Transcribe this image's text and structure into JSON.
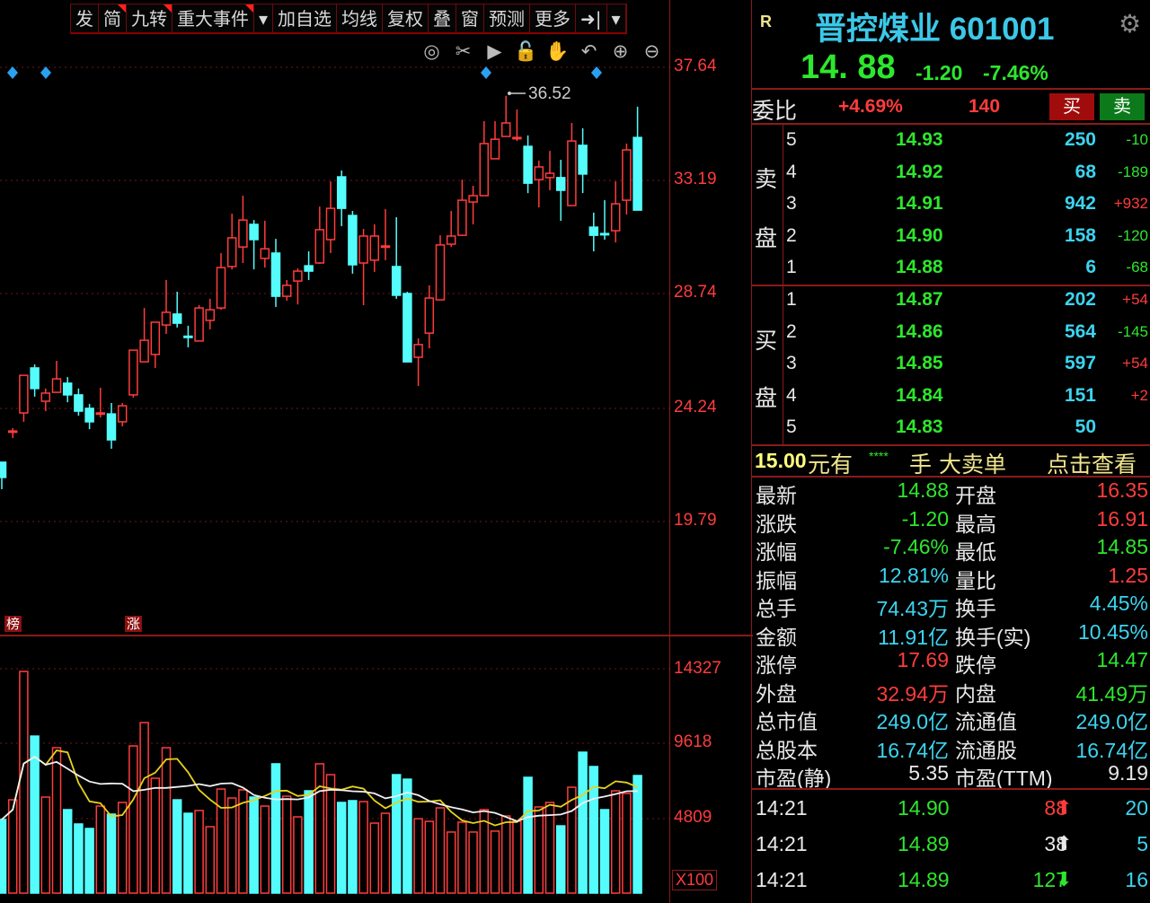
{
  "toolbar": {
    "items": [
      {
        "label": "发",
        "flag": false
      },
      {
        "label": "简",
        "flag": true
      },
      {
        "label": "九转",
        "flag": true
      },
      {
        "label": "重大事件",
        "flag": true
      },
      {
        "label": "▾",
        "flag": false
      },
      {
        "label": "加自选",
        "flag": false
      },
      {
        "label": "均线",
        "flag": false
      },
      {
        "label": "复权",
        "flag": false
      },
      {
        "label": "叠",
        "flag": false
      },
      {
        "label": "窗",
        "flag": false
      },
      {
        "label": "预测",
        "flag": false
      },
      {
        "label": "更多",
        "flag": false
      },
      {
        "label": "➜|",
        "flag": false
      },
      {
        "label": "▾",
        "flag": false
      }
    ],
    "icons": [
      "eye-icon",
      "scissors-icon",
      "play-icon",
      "lock-icon",
      "hand-icon",
      "undo-icon",
      "zoom-in-icon",
      "zoom-out-icon"
    ]
  },
  "chart_data": {
    "type": "candlestick",
    "price_axis": {
      "ticks": [
        "37.64",
        "33.19",
        "28.74",
        "24.24",
        "19.79"
      ],
      "range": [
        19.79,
        37.64
      ]
    },
    "high_label": "36.52",
    "markers": [
      {
        "label": "榜"
      },
      {
        "label": "涨"
      }
    ],
    "volume_axis": {
      "ticks": [
        "14327",
        "9618",
        "4809"
      ],
      "unit": "X100"
    },
    "ma_periods": [
      5,
      10
    ],
    "colors": {
      "up": "#ff3c3c",
      "down": "#54fcfc",
      "ma5": "#e6d21e",
      "ma10": "#f0f0f0",
      "event": "#2aa0f0"
    },
    "event_candles": [
      1,
      4,
      44,
      54
    ],
    "candles": [
      [
        22.1,
        21.5,
        22.1,
        21.04
      ],
      [
        23.3,
        23.33,
        23.44,
        23.05
      ],
      [
        24.04,
        25.52,
        25.52,
        23.69
      ],
      [
        25.81,
        25.0,
        25.95,
        24.68
      ],
      [
        24.5,
        24.82,
        25.0,
        24.11
      ],
      [
        24.85,
        25.38,
        26.09,
        24.85
      ],
      [
        25.21,
        24.75,
        25.45,
        24.46
      ],
      [
        24.75,
        24.11,
        25.0,
        23.93
      ],
      [
        24.22,
        23.69,
        24.39,
        23.4
      ],
      [
        24.0,
        24.04,
        25.03,
        23.86
      ],
      [
        24.0,
        22.98,
        24.43,
        22.63
      ],
      [
        23.69,
        24.32,
        24.43,
        23.51
      ],
      [
        24.75,
        26.51,
        26.51,
        24.64
      ],
      [
        26.05,
        26.9,
        28.17,
        26.05
      ],
      [
        26.34,
        27.61,
        27.61,
        25.81
      ],
      [
        27.5,
        28.0,
        29.27,
        27.15
      ],
      [
        27.93,
        27.57,
        28.81,
        27.4
      ],
      [
        27.06,
        27.04,
        27.47,
        26.62
      ],
      [
        26.87,
        28.17,
        28.28,
        26.87
      ],
      [
        27.68,
        28.1,
        28.53,
        27.33
      ],
      [
        28.17,
        29.76,
        30.33,
        28.1
      ],
      [
        29.8,
        30.93,
        31.88,
        29.69
      ],
      [
        30.57,
        31.63,
        32.59,
        29.94
      ],
      [
        31.46,
        30.86,
        31.63,
        29.69
      ],
      [
        30.12,
        30.5,
        31.6,
        29.76
      ],
      [
        30.33,
        28.63,
        30.89,
        28.21
      ],
      [
        28.63,
        29.06,
        29.27,
        28.46
      ],
      [
        29.23,
        29.62,
        29.73,
        28.31
      ],
      [
        29.83,
        29.62,
        30.4,
        29.27
      ],
      [
        29.94,
        31.25,
        32.16,
        29.9
      ],
      [
        30.86,
        32.09,
        33.15,
        30.33
      ],
      [
        33.33,
        32.09,
        33.58,
        31.39
      ],
      [
        31.81,
        29.87,
        31.99,
        29.52
      ],
      [
        29.94,
        31.0,
        31.28,
        28.28
      ],
      [
        30.05,
        31.0,
        31.46,
        29.59
      ],
      [
        30.58,
        30.61,
        32.06,
        30.05
      ],
      [
        29.8,
        28.67,
        31.74,
        28.53
      ],
      [
        28.74,
        26.05,
        28.81,
        26.05
      ],
      [
        26.23,
        26.73,
        26.97,
        25.1
      ],
      [
        27.18,
        28.56,
        29.06,
        26.58
      ],
      [
        28.49,
        30.65,
        31.03,
        28.49
      ],
      [
        30.68,
        31.0,
        31.99,
        30.57
      ],
      [
        31.03,
        32.41,
        33.22,
        31.0
      ],
      [
        32.34,
        32.59,
        32.98,
        31.46
      ],
      [
        32.59,
        34.64,
        35.52,
        32.59
      ],
      [
        34.04,
        34.81,
        35.52,
        34.04
      ],
      [
        34.92,
        35.45,
        36.52,
        34.92
      ],
      [
        34.85,
        34.88,
        35.98,
        34.74
      ],
      [
        34.53,
        33.08,
        34.96,
        32.69
      ],
      [
        33.22,
        33.72,
        33.97,
        32.13
      ],
      [
        33.3,
        33.47,
        34.35,
        32.8
      ],
      [
        33.3,
        32.8,
        34.0,
        31.6
      ],
      [
        32.2,
        34.74,
        35.45,
        32.2
      ],
      [
        34.57,
        33.44,
        35.24,
        32.69
      ],
      [
        31.35,
        31.03,
        31.92,
        30.4
      ],
      [
        31.1,
        31.07,
        32.41,
        30.86
      ],
      [
        31.21,
        32.27,
        33.15,
        30.75
      ],
      [
        32.41,
        34.39,
        34.64,
        31.85
      ],
      [
        34.88,
        32.02,
        36.09,
        32.02
      ]
    ],
    "volumes": [
      4750,
      6020,
      14300,
      10130,
      6195,
      9380,
      5385,
      4460,
      4170,
      5615,
      5095,
      5850,
      9495,
      11000,
      7410,
      9380,
      6020,
      5150,
      5330,
      4285,
      6715,
      6135,
      6660,
      6195,
      5615,
      8340,
      6250,
      4920,
      6600,
      8340,
      7640,
      5850,
      5965,
      5905,
      4515,
      5150,
      7640,
      7350,
      4800,
      4630,
      5500,
      3940,
      4575,
      3940,
      5385,
      4000,
      4980,
      4630,
      7470,
      5560,
      5850,
      4340,
      6830,
      9090,
      8165,
      5385,
      6600,
      6430,
      7585
    ]
  },
  "quote": {
    "r_badge": "R",
    "name_code": "晋控煤业 601001",
    "price": "14. 88",
    "change": "-1.20",
    "pct": "-7.46%"
  },
  "weibi": {
    "label": "委比",
    "pct": "+4.69%",
    "diff": "140",
    "buy": "买",
    "sell": "卖"
  },
  "sell_label": [
    "卖",
    "盘"
  ],
  "buy_label": [
    "买",
    "盘"
  ],
  "asks": [
    {
      "lv": "5",
      "p": "14.93",
      "v": "250",
      "d": "-10",
      "dc": "g"
    },
    {
      "lv": "4",
      "p": "14.92",
      "v": "68",
      "d": "-189",
      "dc": "g"
    },
    {
      "lv": "3",
      "p": "14.91",
      "v": "942",
      "d": "+932",
      "dc": "r"
    },
    {
      "lv": "2",
      "p": "14.90",
      "v": "158",
      "d": "-120",
      "dc": "g"
    },
    {
      "lv": "1",
      "p": "14.88",
      "v": "6",
      "d": "-68",
      "dc": "g"
    }
  ],
  "bids": [
    {
      "lv": "1",
      "p": "14.87",
      "v": "202",
      "d": "+54",
      "dc": "r"
    },
    {
      "lv": "2",
      "p": "14.86",
      "v": "564",
      "d": "-145",
      "dc": "g"
    },
    {
      "lv": "3",
      "p": "14.85",
      "v": "597",
      "d": "+54",
      "dc": "r"
    },
    {
      "lv": "4",
      "p": "14.84",
      "v": "151",
      "d": "+2",
      "dc": "r"
    },
    {
      "lv": "5",
      "p": "14.83",
      "v": "50",
      "d": "",
      "dc": "g"
    }
  ],
  "bigorder": {
    "price": "15.00",
    "t1": "元有",
    "stars": "****",
    "t2": "手",
    "t3": "大卖单",
    "link": "点击查看"
  },
  "stats": [
    {
      "l1": "最新",
      "v1": "14.88",
      "c1": "g",
      "l2": "开盘",
      "v2": "16.35",
      "c2": "r"
    },
    {
      "l1": "涨跌",
      "v1": "-1.20",
      "c1": "g",
      "l2": "最高",
      "v2": "16.91",
      "c2": "r"
    },
    {
      "l1": "涨幅",
      "v1": "-7.46%",
      "c1": "g",
      "l2": "最低",
      "v2": "14.85",
      "c2": "g"
    },
    {
      "l1": "振幅",
      "v1": "12.81%",
      "c1": "c",
      "l2": "量比",
      "v2": "1.25",
      "c2": "r"
    },
    {
      "l1": "总手",
      "v1": "74.43万",
      "c1": "c",
      "l2": "换手",
      "v2": "4.45%",
      "c2": "c"
    },
    {
      "l1": "金额",
      "v1": "11.91亿",
      "c1": "c",
      "l2": "换手(实)",
      "v2": "10.45%",
      "c2": "c"
    },
    {
      "l1": "涨停",
      "v1": "17.69",
      "c1": "r",
      "l2": "跌停",
      "v2": "14.47",
      "c2": "g"
    },
    {
      "l1": "外盘",
      "v1": "32.94万",
      "c1": "r",
      "l2": "内盘",
      "v2": "41.49万",
      "c2": "g"
    },
    {
      "l1": "总市值",
      "v1": "249.0亿",
      "c1": "c",
      "l2": "流通值",
      "v2": "249.0亿",
      "c2": "c"
    },
    {
      "l1": "总股本",
      "v1": "16.74亿",
      "c1": "c",
      "l2": "流通股",
      "v2": "16.74亿",
      "c2": "c"
    },
    {
      "l1": "市盈(静)",
      "v1": "5.35",
      "c1": "w",
      "l2": "市盈(TTM)",
      "v2": "9.19",
      "c2": "w"
    }
  ],
  "ticks": [
    {
      "t": "14:21",
      "p": "14.90",
      "v": "88",
      "vc": "r",
      "dir": "up",
      "n": "20"
    },
    {
      "t": "14:21",
      "p": "14.89",
      "v": "38",
      "vc": "w",
      "dir": "up",
      "n": "5"
    },
    {
      "t": "14:21",
      "p": "14.89",
      "v": "127",
      "vc": "g",
      "dir": "down",
      "n": "16"
    }
  ]
}
